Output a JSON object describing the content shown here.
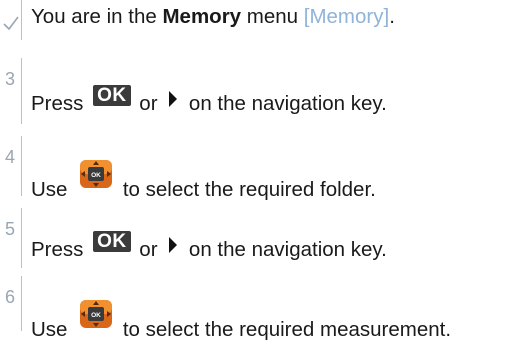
{
  "steps": [
    {
      "marker": "✓",
      "marker_icon": "check-icon",
      "text_before": "You are in the ",
      "bold": "Memory",
      "text_middle": " menu ",
      "link": "[Memory]",
      "text_after": "."
    },
    {
      "marker": "3",
      "text_before": "Press ",
      "key": "OK",
      "text_middle": " or ",
      "arrow_icon": "right-arrow-icon",
      "text_after": " on the navigation key."
    },
    {
      "marker": "4",
      "text_before": "Use ",
      "key_icon": "navigation-key-icon",
      "text_after": " to select the required folder."
    },
    {
      "marker": "5",
      "text_before": "Press ",
      "key": "OK",
      "text_middle": " or ",
      "arrow_icon": "right-arrow-icon",
      "text_after": " on the navigation key."
    },
    {
      "marker": "6",
      "text_before": "Use ",
      "key_icon": "navigation-key-icon",
      "text_after": " to select the required measurement."
    }
  ],
  "colors": {
    "marker": "#9aa6b4",
    "link": "#8fb3d9",
    "ok_key_bg": "#3b3b3b",
    "nav_key_orange": "#e07a1f"
  }
}
